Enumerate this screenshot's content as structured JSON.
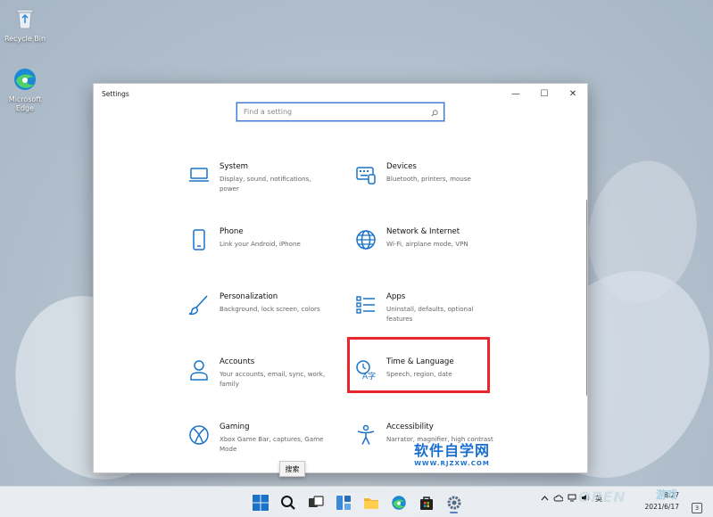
{
  "desktop": {
    "icons": [
      {
        "label": "Recycle Bin",
        "icon": "recycle-bin-icon"
      },
      {
        "label": "Microsoft Edge",
        "icon": "edge-icon"
      }
    ]
  },
  "window": {
    "title": "Settings",
    "controls": {
      "minimize": "—",
      "maximize": "☐",
      "close": "✕"
    },
    "search_placeholder": "Find a setting"
  },
  "categories": [
    {
      "name": "System",
      "desc": "Display, sound, notifications, power",
      "icon": "laptop-icon"
    },
    {
      "name": "Devices",
      "desc": "Bluetooth, printers, mouse",
      "icon": "keyboard-icon"
    },
    {
      "name": "Phone",
      "desc": "Link your Android, iPhone",
      "icon": "phone-icon"
    },
    {
      "name": "Network & Internet",
      "desc": "Wi-Fi, airplane mode, VPN",
      "icon": "globe-icon"
    },
    {
      "name": "Personalization",
      "desc": "Background, lock screen, colors",
      "icon": "brush-icon"
    },
    {
      "name": "Apps",
      "desc": "Uninstall, defaults, optional features",
      "icon": "apps-list-icon"
    },
    {
      "name": "Accounts",
      "desc": "Your accounts, email, sync, work, family",
      "icon": "person-icon"
    },
    {
      "name": "Time & Language",
      "desc": "Speech, region, date",
      "icon": "time-language-icon"
    },
    {
      "name": "Gaming",
      "desc": "Xbox Game Bar, captures, Game Mode",
      "icon": "xbox-icon"
    },
    {
      "name": "Accessibility",
      "desc": "Narrator, magnifier, high contrast",
      "icon": "accessibility-icon"
    }
  ],
  "tooltip": "搜索",
  "taskbar": {
    "apps": [
      "windows-start-icon",
      "search-icon",
      "task-view-icon",
      "widgets-icon",
      "file-explorer-icon",
      "edge-icon",
      "store-icon",
      "settings-icon"
    ],
    "tray": {
      "lang": "英"
    },
    "clock": {
      "time": "8:27",
      "date": "2021/6/17"
    },
    "notifications": "3"
  },
  "watermarks": {
    "main": "软件自学网",
    "url": "WWW.RJZXW.COM",
    "corner": "OPEN",
    "corner2": "游戏"
  },
  "colors": {
    "accent": "#1a73c8",
    "highlight": "#e8262c"
  }
}
